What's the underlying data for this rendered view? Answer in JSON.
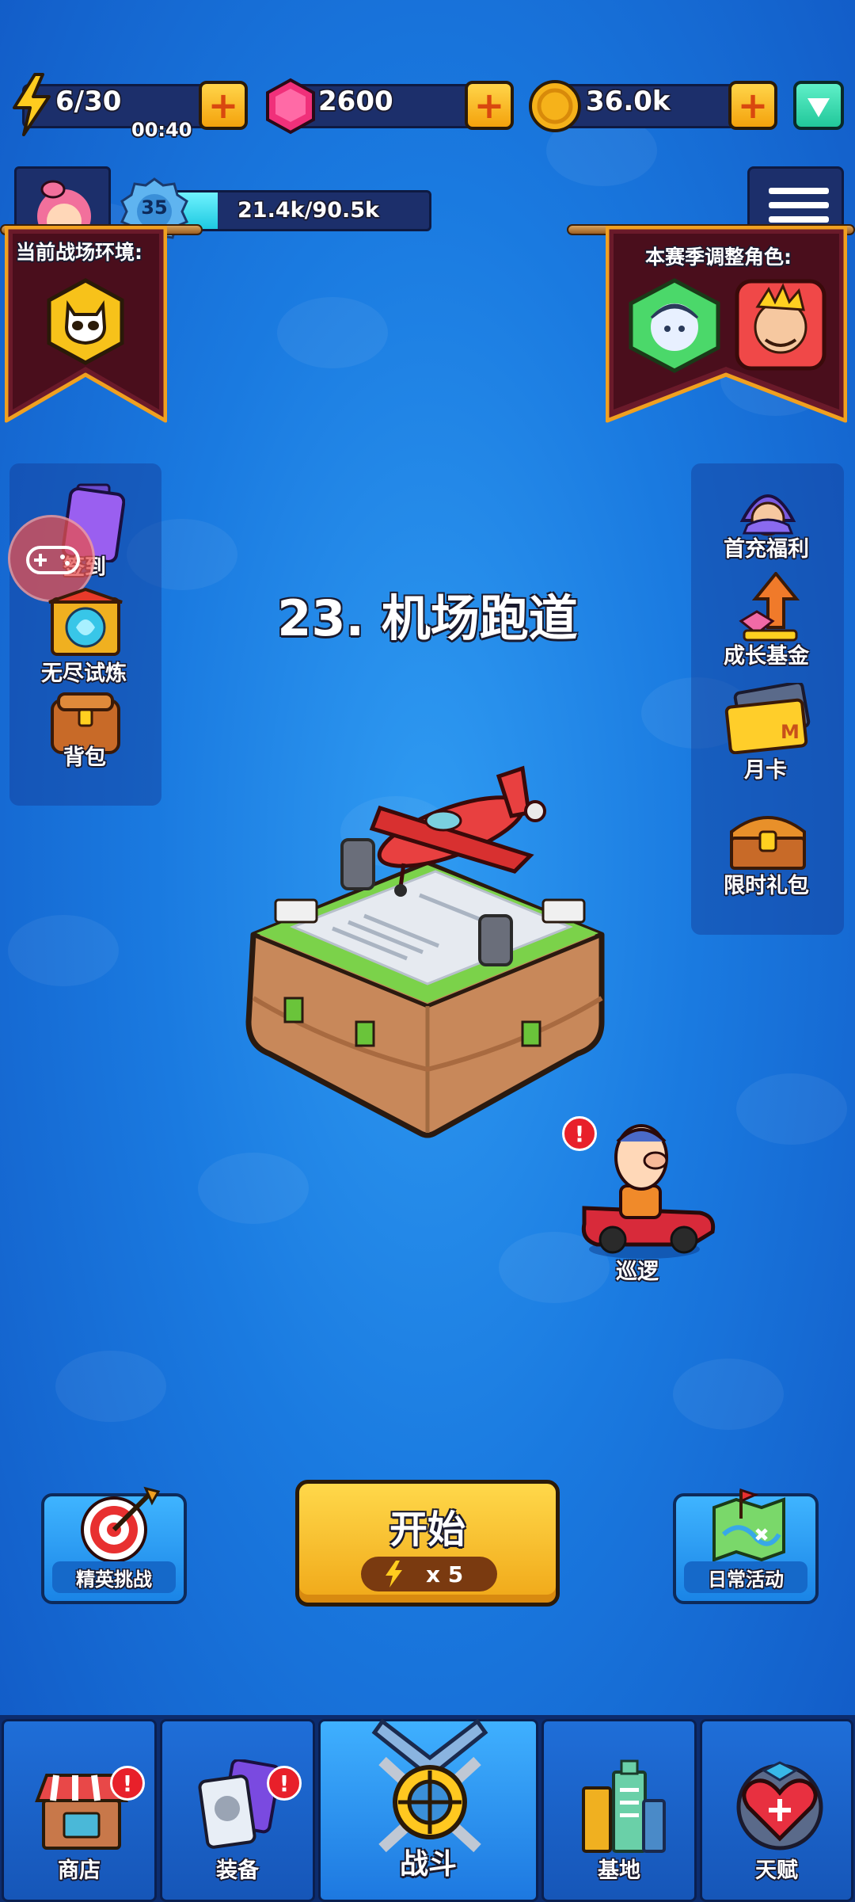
{
  "resources": {
    "energy": "6/30",
    "energy_timer": "00:40",
    "gems": "2600",
    "coins": "36.0k"
  },
  "player": {
    "level": "35",
    "xp": "21.4k/90.5k",
    "xp_progress": 0.236
  },
  "banners": {
    "left_title": "当前战场环境:",
    "right_title": "本赛季调整角色:"
  },
  "left_menu": {
    "checkin": "签到",
    "endless": "无尽试炼",
    "backpack": "背包"
  },
  "right_menu": {
    "first_charge": "首充福利",
    "growth_fund": "成长基金",
    "month_card": "月卡",
    "limited_pack": "限时礼包"
  },
  "stage": {
    "title": "23. 机场跑道"
  },
  "patrol": {
    "label": "巡逻"
  },
  "actions": {
    "elite": "精英挑战",
    "start": "开始",
    "cost": "x 5",
    "daily": "日常活动"
  },
  "nav": {
    "shop": "商店",
    "equipment": "装备",
    "battle": "战斗",
    "base": "基地",
    "talent": "天赋"
  },
  "colors": {
    "accent": "#f4b81c",
    "background": "#1a7ae0",
    "alert": "#e8202a"
  }
}
